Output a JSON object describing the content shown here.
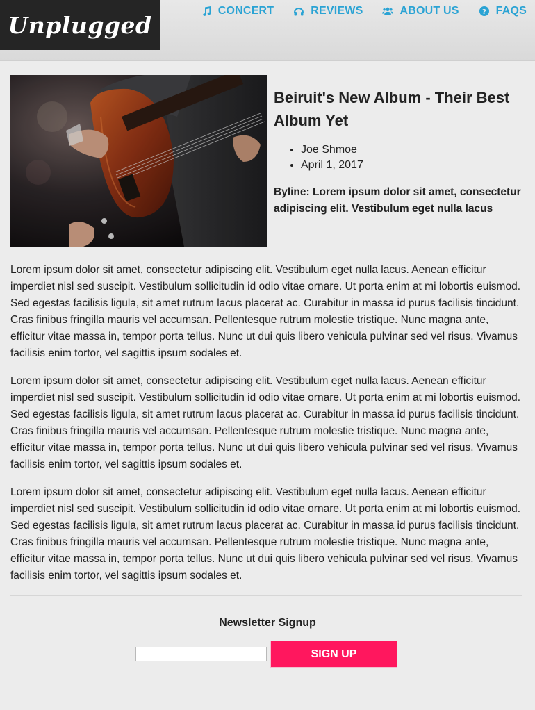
{
  "header": {
    "logo_text": "Unplugged",
    "nav": [
      {
        "label": "CONCERT",
        "icon": "music-note-icon"
      },
      {
        "label": "REVIEWS",
        "icon": "headphones-icon"
      },
      {
        "label": "ABOUT US",
        "icon": "users-icon"
      },
      {
        "label": "FAQS",
        "icon": "question-circle-icon"
      }
    ]
  },
  "article": {
    "image_icon": "guitar-photo",
    "title": "Beiruit's New Album - Their Best Album Yet",
    "author": "Joe Shmoe",
    "date": "April 1, 2017",
    "byline": "Byline: Lorem ipsum dolor sit amet, consectetur adipiscing elit. Vestibulum eget nulla lacus",
    "paragraphs": [
      "Lorem ipsum dolor sit amet, consectetur adipiscing elit. Vestibulum eget nulla lacus. Aenean efficitur imperdiet nisl sed suscipit. Vestibulum sollicitudin id odio vitae ornare. Ut porta enim at mi lobortis euismod. Sed egestas facilisis ligula, sit amet rutrum lacus placerat ac. Curabitur in massa id purus facilisis tincidunt. Cras finibus fringilla mauris vel accumsan. Pellentesque rutrum molestie tristique. Nunc magna ante, efficitur vitae massa in, tempor porta tellus. Nunc ut dui quis libero vehicula pulvinar sed vel risus. Vivamus facilisis enim tortor, vel sagittis ipsum sodales et.",
      "Lorem ipsum dolor sit amet, consectetur adipiscing elit. Vestibulum eget nulla lacus. Aenean efficitur imperdiet nisl sed suscipit. Vestibulum sollicitudin id odio vitae ornare. Ut porta enim at mi lobortis euismod. Sed egestas facilisis ligula, sit amet rutrum lacus placerat ac. Curabitur in massa id purus facilisis tincidunt. Cras finibus fringilla mauris vel accumsan. Pellentesque rutrum molestie tristique. Nunc magna ante, efficitur vitae massa in, tempor porta tellus. Nunc ut dui quis libero vehicula pulvinar sed vel risus. Vivamus facilisis enim tortor, vel sagittis ipsum sodales et.",
      "Lorem ipsum dolor sit amet, consectetur adipiscing elit. Vestibulum eget nulla lacus. Aenean efficitur imperdiet nisl sed suscipit. Vestibulum sollicitudin id odio vitae ornare. Ut porta enim at mi lobortis euismod. Sed egestas facilisis ligula, sit amet rutrum lacus placerat ac. Curabitur in massa id purus facilisis tincidunt. Cras finibus fringilla mauris vel accumsan. Pellentesque rutrum molestie tristique. Nunc magna ante, efficitur vitae massa in, tempor porta tellus. Nunc ut dui quis libero vehicula pulvinar sed vel risus. Vivamus facilisis enim tortor, vel sagittis ipsum sodales et."
    ]
  },
  "newsletter": {
    "title": "Newsletter Signup",
    "input_value": "",
    "button_label": "SIGN UP"
  },
  "colors": {
    "nav_link": "#2aa3d4",
    "logo_bg": "#252525",
    "signup_button": "#ff175e",
    "page_bg": "#ececec"
  }
}
